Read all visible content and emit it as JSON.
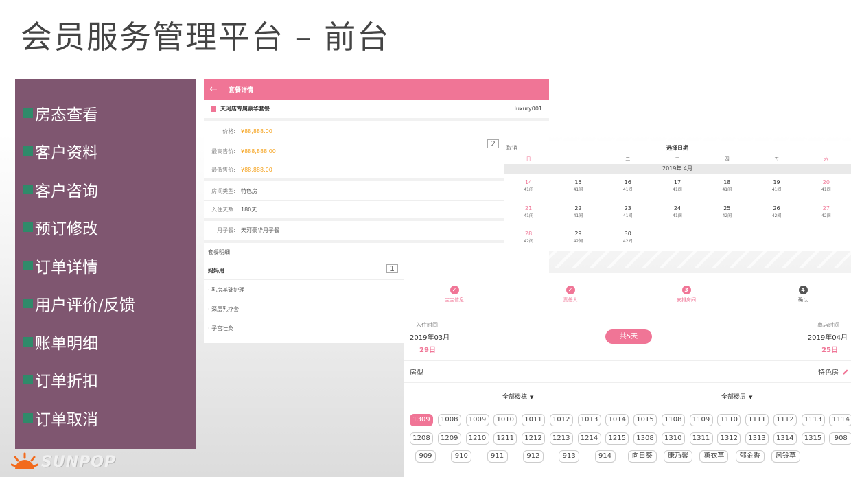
{
  "slide": {
    "title": "会员服务管理平台 – 前台"
  },
  "menu": {
    "items": [
      "房态查看",
      "客户资料",
      "客户咨询",
      "预订修改",
      "订单详情",
      "用户评价/反馈",
      "账单明细",
      "订单折扣",
      "订单取消"
    ]
  },
  "logo": {
    "text": "SUNPOP"
  },
  "badges": {
    "one": "1",
    "two": "2"
  },
  "package": {
    "header_title": "套餐详情",
    "name": "天河店专属豪华套餐",
    "code": "luxury001",
    "price_label": "价格:",
    "price": "¥88,888.00",
    "max_label": "最高售价:",
    "max": "¥888,888.00",
    "min_label": "最低售价:",
    "min": "¥88,888.00",
    "roomtype_label": "房间类型:",
    "roomtype": "特色房",
    "days_label": "入住天数:",
    "days": "180天",
    "meal_label": "月子餐:",
    "meal": "天河豪华月子餐",
    "detail_section": "套餐明细",
    "mother_section": "妈妈用",
    "items": [
      "· 乳房基础护理",
      "· 深层乳疗套",
      "· 子宫壮灸"
    ]
  },
  "calendar": {
    "cancel": "取消",
    "title": "选择日期",
    "weekdays": [
      "日",
      "一",
      "二",
      "三",
      "四",
      "五",
      "六"
    ],
    "month": "2019年 4月",
    "weeks": [
      [
        {
          "d": "14",
          "r": "41间"
        },
        {
          "d": "15",
          "r": "41间"
        },
        {
          "d": "16",
          "r": "41间"
        },
        {
          "d": "17",
          "r": "41间"
        },
        {
          "d": "18",
          "r": "41间"
        },
        {
          "d": "19",
          "r": "41间"
        },
        {
          "d": "20",
          "r": "41间"
        }
      ],
      [
        {
          "d": "21",
          "r": "41间"
        },
        {
          "d": "22",
          "r": "41间"
        },
        {
          "d": "23",
          "r": "41间"
        },
        {
          "d": "24",
          "r": "41间"
        },
        {
          "d": "25",
          "r": "42间"
        },
        {
          "d": "26",
          "r": "42间"
        },
        {
          "d": "27",
          "r": "42间"
        }
      ],
      [
        {
          "d": "28",
          "r": "42间"
        },
        {
          "d": "29",
          "r": "42间"
        },
        {
          "d": "30",
          "r": "42间"
        }
      ]
    ]
  },
  "booking": {
    "steps": [
      {
        "num": "✓",
        "label": "宝宝信息"
      },
      {
        "num": "✓",
        "label": "责任人"
      },
      {
        "num": "3",
        "label": "安排房间"
      },
      {
        "num": "4",
        "label": "确认"
      }
    ],
    "checkin_label": "入住时间",
    "checkin_month": "2019年03月",
    "checkin_day": "29日",
    "checkout_label": "离店时间",
    "checkout_month": "2019年04月",
    "checkout_day": "25日",
    "nights": "共5天",
    "roomtype_label": "房型",
    "roomtype_value": "特色房",
    "filter_building": "全部楼栋",
    "filter_floor": "全部楼层",
    "rooms": [
      [
        "1309",
        "1008",
        "1009",
        "1010",
        "1011",
        "1012",
        "1013",
        "1014",
        "1015",
        "1108",
        "1109",
        "1110",
        "1111",
        "1112",
        "1113",
        "1114"
      ],
      [
        "1208",
        "1209",
        "1210",
        "1211",
        "1212",
        "1213",
        "1214",
        "1215",
        "1308",
        "1310",
        "1311",
        "1312",
        "1313",
        "1314",
        "1315",
        "908"
      ],
      [
        "909",
        "910",
        "911",
        "912",
        "913",
        "914",
        "向日葵",
        "康乃馨",
        "薰衣草",
        "郁金香",
        "风铃草"
      ]
    ],
    "selected_room": "1309"
  },
  "colors": {
    "accent": "#f07596",
    "menu_bg": "#7f5670",
    "price": "#f5a11a",
    "bullet": "#2f8a6a"
  }
}
